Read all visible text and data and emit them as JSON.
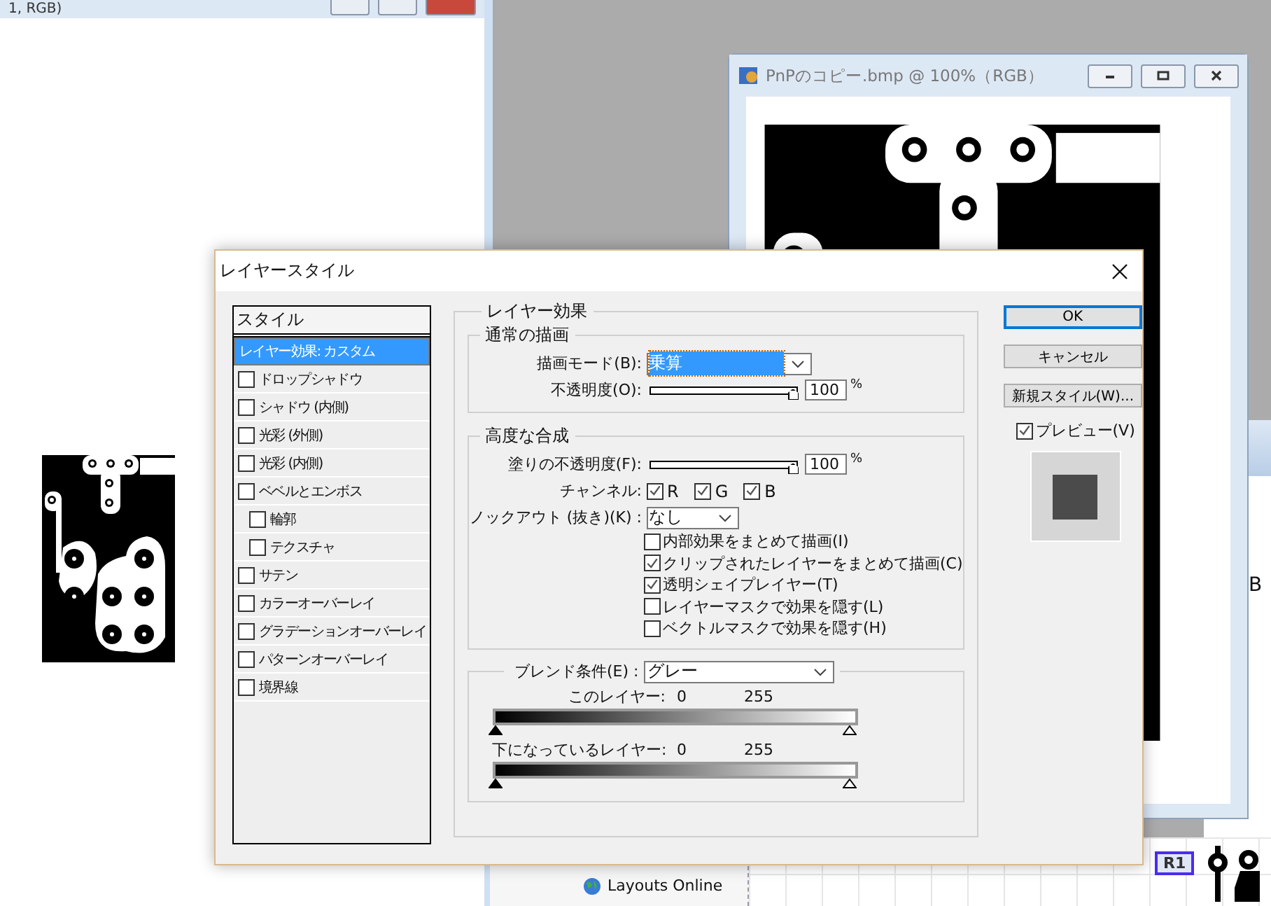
{
  "left_window": {
    "title": "1, RGB)"
  },
  "document_window": {
    "title": "PnPのコピー.bmp @ 100%（RGB）"
  },
  "back_window": {
    "text": "B"
  },
  "layout_editor": {
    "panel_item": "Layouts Online",
    "part_label": "R1"
  },
  "dialog": {
    "title": "レイヤースタイル",
    "styles": {
      "header": "スタイル",
      "items": [
        {
          "kind": "summary",
          "label": "レイヤー効果: カスタム",
          "selected": true
        },
        {
          "kind": "checkbox",
          "label": "ドロップシャドウ",
          "checked": false,
          "selected": false
        },
        {
          "kind": "checkbox",
          "label": "シャドウ (内側)",
          "checked": false,
          "selected": false
        },
        {
          "kind": "checkbox",
          "label": "光彩 (外側)",
          "checked": false,
          "selected": false
        },
        {
          "kind": "checkbox",
          "label": "光彩 (内側)",
          "checked": false,
          "selected": false
        },
        {
          "kind": "checkbox",
          "label": "ベベルとエンボス",
          "checked": false,
          "selected": false,
          "children": [
            {
              "kind": "checkbox",
              "label": "輪郭",
              "checked": false,
              "selected": false
            },
            {
              "kind": "checkbox",
              "label": "テクスチャ",
              "checked": false,
              "selected": false
            }
          ]
        },
        {
          "kind": "checkbox",
          "label": "サテン",
          "checked": false,
          "selected": false
        },
        {
          "kind": "checkbox",
          "label": "カラーオーバーレイ",
          "checked": false,
          "selected": false
        },
        {
          "kind": "checkbox",
          "label": "グラデーションオーバーレイ",
          "checked": false,
          "selected": false
        },
        {
          "kind": "checkbox",
          "label": "パターンオーバーレイ",
          "checked": false,
          "selected": false
        },
        {
          "kind": "checkbox",
          "label": "境界線",
          "checked": false,
          "selected": false
        }
      ]
    },
    "layer_effects": {
      "title": "レイヤー効果",
      "normal": {
        "title": "通常の描画",
        "blend_mode": {
          "label": "描画モード(B):",
          "value": "乗算"
        },
        "opacity": {
          "label": "不透明度(O):",
          "level": 1,
          "value": "100",
          "unit": "%"
        }
      },
      "advanced": {
        "title": "高度な合成",
        "fill_opacity": {
          "label": "塗りの不透明度(F):",
          "level": 1,
          "value": "100",
          "unit": "%"
        },
        "channels": {
          "label": "チャンネル:",
          "items": [
            {
              "label": "R",
              "checked": true
            },
            {
              "label": "G",
              "checked": true
            },
            {
              "label": "B",
              "checked": true
            }
          ]
        },
        "knockout": {
          "label": "ノックアウト (抜き)(K) :",
          "value": "なし"
        },
        "options": [
          {
            "label": "内部効果をまとめて描画(I)",
            "checked": false
          },
          {
            "label": "クリップされたレイヤーをまとめて描画(C)",
            "checked": true
          },
          {
            "label": "透明シェイプレイヤー(T)",
            "checked": true
          },
          {
            "label": "レイヤーマスクで効果を隠す(L)",
            "checked": false
          },
          {
            "label": "ベクトルマスクで効果を隠す(H)",
            "checked": false
          }
        ]
      },
      "blend_if": {
        "label": "ブレンド条件(E) :",
        "value": "グレー",
        "sliders": [
          {
            "label": "このレイヤー:",
            "low": "0",
            "high": "255"
          },
          {
            "label": "下になっているレイヤー:",
            "low": "0",
            "high": "255"
          }
        ]
      }
    },
    "buttons": [
      {
        "label": "OK",
        "default": true
      },
      {
        "label": "キャンセル",
        "default": false
      },
      {
        "label": "新規スタイル(W)...",
        "default": false
      }
    ],
    "preview": {
      "label": "プレビュー(V)",
      "checked": true
    }
  }
}
